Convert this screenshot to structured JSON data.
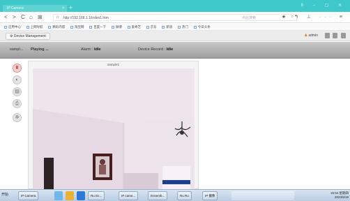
{
  "browser": {
    "tab_title": "IP Camera",
    "tab_close": "×",
    "new_tab": "+",
    "window_controls": "8 – ▢ ✕",
    "nav_buttons": [
      "<",
      ">",
      "C",
      "⌂",
      "⊞",
      "☆"
    ],
    "url": "http://192.168.1.1/index1.htm",
    "search_placeholder": "点此搜索",
    "right_icons": "★ ↰ ⊥ ··· ≡"
  },
  "bookmarks": [
    "应用中心",
    "上网导航",
    "精彩内容",
    "淘宝网",
    "百度一下",
    "微博",
    "爱奇艺",
    "京东",
    "新浪",
    "热门",
    "今日头条"
  ],
  "app": {
    "device_tab": "Device Management",
    "user": "admin",
    "status": {
      "camera": "sampl...",
      "playing": "Playing ...",
      "alarm_label": "Alarm :",
      "alarm_value": "Idle",
      "record_label": "Device Record :",
      "record_value": "Idle"
    },
    "video_title": "sample1",
    "side_buttons": [
      "II",
      "◐",
      "▤",
      "⎙",
      "✲"
    ]
  },
  "taskbar": {
    "start": "开始",
    "items": [
      "IP Camera",
      "Ru Dz...",
      "IP came...",
      "Ensemb...",
      "Ru Ru",
      "IP 摄像"
    ],
    "clock_time": "16:53 星期四",
    "clock_date": "2023/5/18"
  }
}
